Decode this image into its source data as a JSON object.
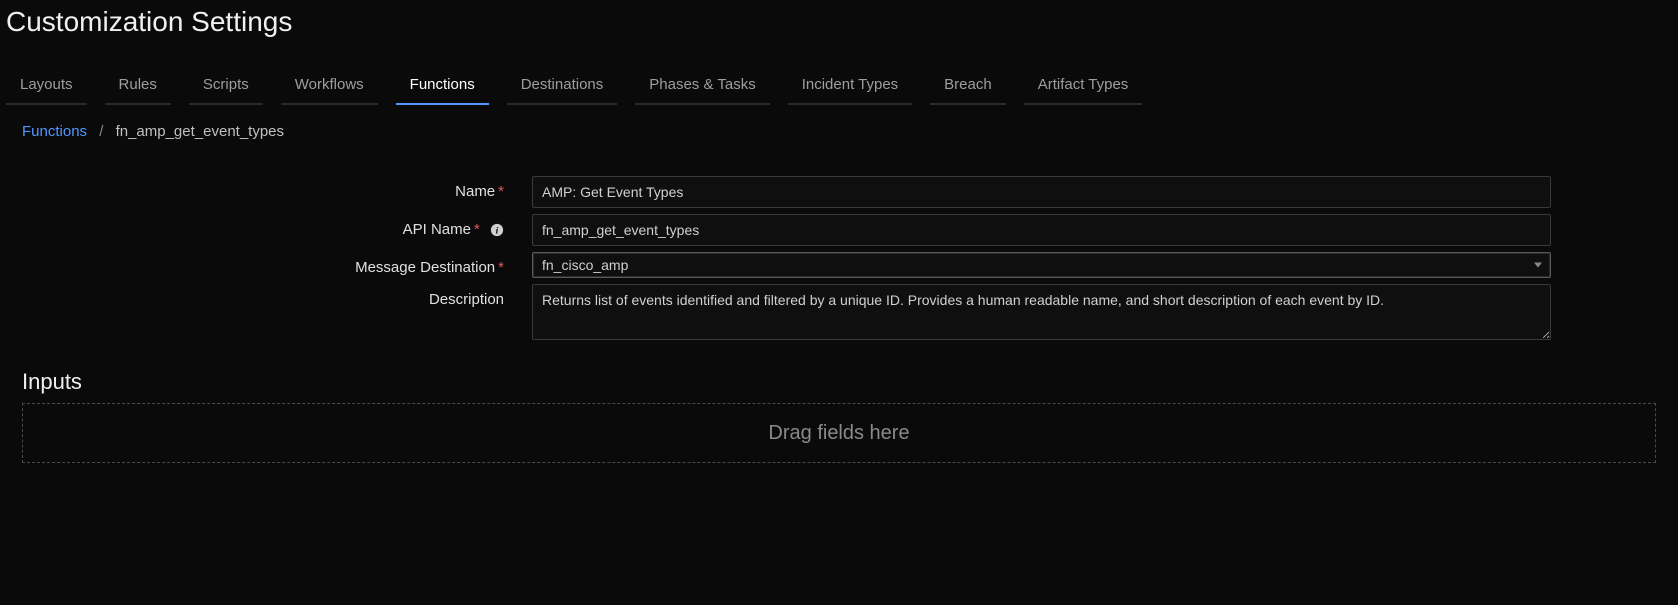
{
  "page": {
    "title": "Customization Settings"
  },
  "tabs": [
    {
      "label": "Layouts",
      "active": false
    },
    {
      "label": "Rules",
      "active": false
    },
    {
      "label": "Scripts",
      "active": false
    },
    {
      "label": "Workflows",
      "active": false
    },
    {
      "label": "Functions",
      "active": true
    },
    {
      "label": "Destinations",
      "active": false
    },
    {
      "label": "Phases & Tasks",
      "active": false
    },
    {
      "label": "Incident Types",
      "active": false
    },
    {
      "label": "Breach",
      "active": false
    },
    {
      "label": "Artifact Types",
      "active": false
    }
  ],
  "breadcrumb": {
    "root": "Functions",
    "current": "fn_amp_get_event_types"
  },
  "form": {
    "name_label": "Name",
    "name_value": "AMP: Get Event Types",
    "api_name_label": "API Name",
    "api_name_value": "fn_amp_get_event_types",
    "message_destination_label": "Message Destination",
    "message_destination_value": "fn_cisco_amp",
    "description_label": "Description",
    "description_value": "Returns list of events identified and filtered by a unique ID. Provides a human readable name, and short description of each event by ID."
  },
  "inputs": {
    "heading": "Inputs",
    "placeholder": "Drag fields here"
  }
}
